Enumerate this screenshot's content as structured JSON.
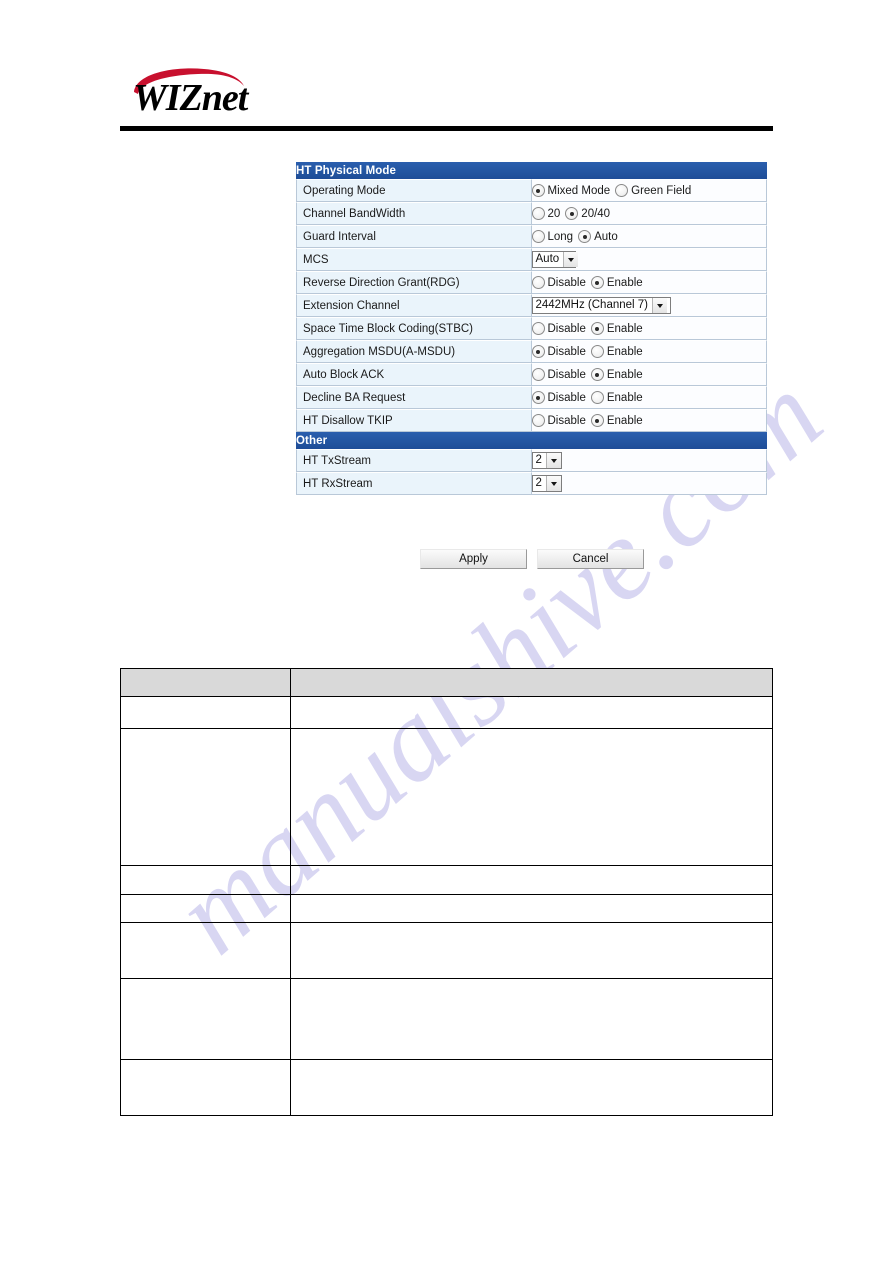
{
  "logo": {
    "text": "WIZnet",
    "swoosh_color": "#c8102e"
  },
  "theme": {
    "section_header_bg": "#23539f",
    "label_cell_bg": "#eaf4fb",
    "value_cell_bg": "#fcfdff",
    "cell_border": "#b9c8d8",
    "desc_header_bg": "#d9d9d9"
  },
  "watermark": {
    "text": "manualshive.com",
    "color": "#b9b6e8"
  },
  "config": {
    "sections": [
      {
        "title": "HT Physical Mode",
        "rows": [
          {
            "label": "Operating Mode",
            "type": "radio",
            "options": [
              {
                "label": "Mixed Mode",
                "selected": true
              },
              {
                "label": "Green Field",
                "selected": false
              }
            ]
          },
          {
            "label": "Channel BandWidth",
            "type": "radio",
            "options": [
              {
                "label": "20",
                "selected": false
              },
              {
                "label": "20/40",
                "selected": true
              }
            ]
          },
          {
            "label": "Guard Interval",
            "type": "radio",
            "options": [
              {
                "label": "Long",
                "selected": false
              },
              {
                "label": "Auto",
                "selected": true
              }
            ]
          },
          {
            "label": "MCS",
            "type": "select",
            "value": "Auto"
          },
          {
            "label": "Reverse Direction Grant(RDG)",
            "type": "radio",
            "options": [
              {
                "label": "Disable",
                "selected": false
              },
              {
                "label": "Enable",
                "selected": true
              }
            ]
          },
          {
            "label": "Extension Channel",
            "type": "select",
            "value": "2442MHz (Channel 7)"
          },
          {
            "label": "Space Time Block Coding(STBC)",
            "type": "radio",
            "options": [
              {
                "label": "Disable",
                "selected": false
              },
              {
                "label": "Enable",
                "selected": true
              }
            ]
          },
          {
            "label": "Aggregation MSDU(A-MSDU)",
            "type": "radio",
            "options": [
              {
                "label": "Disable",
                "selected": true
              },
              {
                "label": "Enable",
                "selected": false
              }
            ]
          },
          {
            "label": "Auto Block ACK",
            "type": "radio",
            "options": [
              {
                "label": "Disable",
                "selected": false
              },
              {
                "label": "Enable",
                "selected": true
              }
            ]
          },
          {
            "label": "Decline BA Request",
            "type": "radio",
            "options": [
              {
                "label": "Disable",
                "selected": true
              },
              {
                "label": "Enable",
                "selected": false
              }
            ]
          },
          {
            "label": "HT Disallow TKIP",
            "type": "radio",
            "options": [
              {
                "label": "Disable",
                "selected": false
              },
              {
                "label": "Enable",
                "selected": true
              }
            ]
          }
        ]
      },
      {
        "title": "Other",
        "rows": [
          {
            "label": "HT TxStream",
            "type": "select",
            "value": "2"
          },
          {
            "label": "HT RxStream",
            "type": "select",
            "value": "2"
          }
        ]
      }
    ]
  },
  "buttons": {
    "apply": "Apply",
    "cancel": "Cancel"
  },
  "description_table": {
    "header": {
      "c1": "",
      "c2": ""
    },
    "rows": [
      {
        "c1": "",
        "c2": ""
      },
      {
        "c1": "",
        "c2": ""
      },
      {
        "c1": "",
        "c2": ""
      },
      {
        "c1": "",
        "c2": ""
      },
      {
        "c1": "",
        "c2": ""
      },
      {
        "c1": "",
        "c2": ""
      },
      {
        "c1": "",
        "c2": ""
      }
    ]
  }
}
